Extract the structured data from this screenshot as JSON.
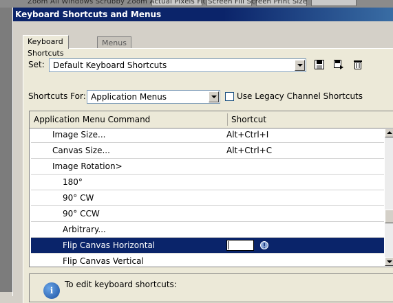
{
  "background_strip": {
    "faded_text": "Zoom All Windows   Scrubby Zoom   Actual Pixels   Fit Screen   Fill Screen   Print Size"
  },
  "dialog": {
    "title": "Keyboard Shortcuts and Menus",
    "tabs": [
      {
        "label": "Keyboard Shortcuts",
        "active": true
      },
      {
        "label": "Menus",
        "active": false
      }
    ],
    "set": {
      "label": "Set:",
      "value": "Default Keyboard Shortcuts",
      "icons": [
        "save-icon",
        "save-as-icon",
        "delete-icon"
      ]
    },
    "shortcuts_for": {
      "label": "Shortcuts For:",
      "value": "Application Menus",
      "legacy_checkbox_label": "Use Legacy Channel Shortcuts",
      "legacy_checked": false
    },
    "table": {
      "columns": [
        "Application Menu Command",
        "Shortcut"
      ],
      "rows": [
        {
          "command": "Image Size...",
          "shortcut": "Alt+Ctrl+I",
          "indent": 1
        },
        {
          "command": "Canvas Size...",
          "shortcut": "Alt+Ctrl+C",
          "indent": 1
        },
        {
          "command": "Image Rotation>",
          "shortcut": "",
          "indent": 1
        },
        {
          "command": "180°",
          "shortcut": "",
          "indent": 2
        },
        {
          "command": "90° CW",
          "shortcut": "",
          "indent": 2
        },
        {
          "command": "90° CCW",
          "shortcut": "",
          "indent": 2
        },
        {
          "command": "Arbitrary...",
          "shortcut": "",
          "indent": 2
        },
        {
          "command": "Flip Canvas Horizontal",
          "shortcut": "",
          "indent": 2,
          "selected": true
        },
        {
          "command": "Flip Canvas Vertical",
          "shortcut": "",
          "indent": 2
        }
      ]
    },
    "info": {
      "heading": "To edit keyboard shortcuts:"
    },
    "colors": {
      "selection": "#0a246a",
      "titlebar": "#0b246a",
      "panel": "#ece9d8"
    }
  }
}
